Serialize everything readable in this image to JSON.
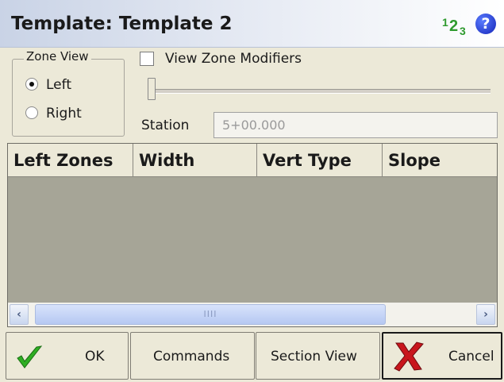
{
  "window": {
    "title": "Template: Template 2",
    "input_mode_icon": "numeric-input-icon",
    "help_icon": "help-icon",
    "help_symbol": "?"
  },
  "zone_view": {
    "legend": "Zone View",
    "options": [
      {
        "label": "Left",
        "checked": true
      },
      {
        "label": "Right",
        "checked": false
      }
    ]
  },
  "view_zone_modifiers": {
    "label": "View Zone Modifiers",
    "checked": false
  },
  "slider": {
    "value_fraction": 0
  },
  "station": {
    "label": "Station",
    "value": "5+00.000"
  },
  "zones_table": {
    "columns": [
      "Left Zones",
      "Width",
      "Vert Type",
      "Slope"
    ],
    "rows": [],
    "scrollbar_grip": "IIII"
  },
  "buttons": {
    "ok": "OK",
    "commands": "Commands",
    "section_view": "Section View",
    "cancel": "Cancel"
  },
  "colors": {
    "table_background": "#a6a597",
    "ok_check": "#2fae23",
    "cancel_x": "#c8161d",
    "help_icon": "#1424b8"
  }
}
